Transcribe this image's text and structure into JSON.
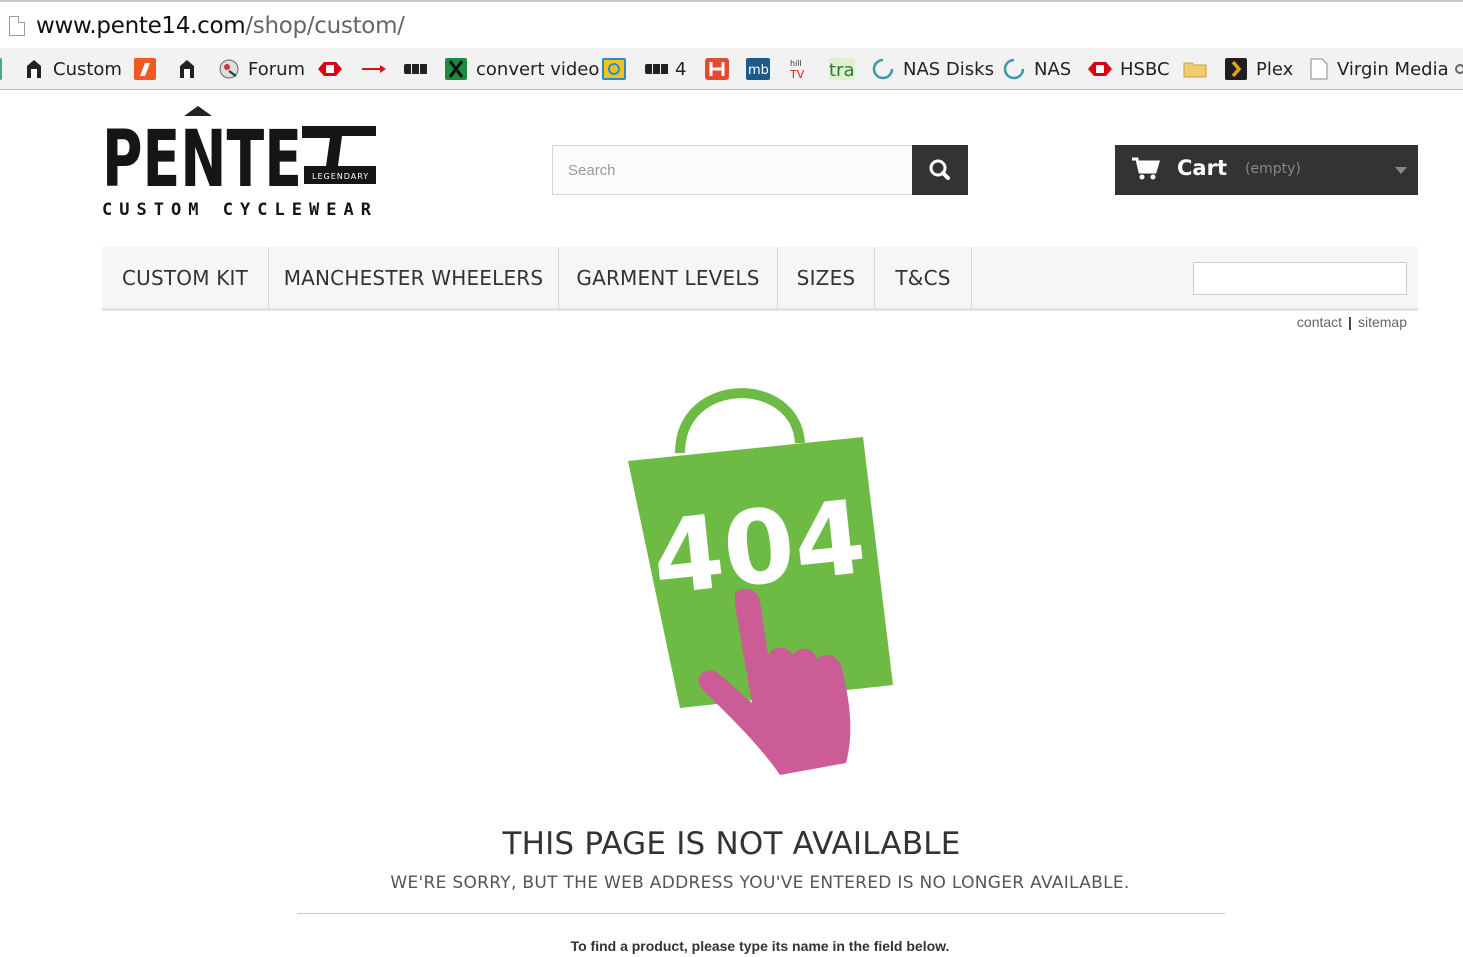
{
  "browser": {
    "url_host": "www.pente14.com",
    "url_path": "/shop/custom/"
  },
  "bookmarks": [
    {
      "label": "Custom",
      "icon": "pente-icon"
    },
    {
      "label": "",
      "icon": "orange-app-icon"
    },
    {
      "label": "",
      "icon": "pente-icon"
    },
    {
      "label": "Forum",
      "icon": "forum-icon"
    },
    {
      "label": "",
      "icon": "hsbc-icon"
    },
    {
      "label": "",
      "icon": "red-arrow-icon"
    },
    {
      "label": "",
      "icon": "bbc-icon"
    },
    {
      "label": "convert video",
      "icon": "convert-icon"
    },
    {
      "label": "",
      "icon": "photo-icon"
    },
    {
      "label": "4",
      "icon": "bbc-icon"
    },
    {
      "label": "",
      "icon": "h-icon"
    },
    {
      "label": "",
      "icon": "mb-icon"
    },
    {
      "label": "",
      "icon": "hill-tv-icon"
    },
    {
      "label": "",
      "icon": "tra-icon"
    },
    {
      "label": "NAS Disks",
      "icon": "spinner-icon"
    },
    {
      "label": "NAS",
      "icon": "spinner-icon"
    },
    {
      "label": "HSBC",
      "icon": "hsbc-icon"
    },
    {
      "label": "",
      "icon": "folder-icon"
    },
    {
      "label": "Plex",
      "icon": "plex-icon"
    },
    {
      "label": "Virgin Media",
      "icon": "page-icon"
    }
  ],
  "header": {
    "search_placeholder": "Search",
    "cart_label": "Cart",
    "cart_status": "(empty)"
  },
  "menu": [
    "CUSTOM KIT",
    "MANCHESTER WHEELERS",
    "GARMENT LEVELS",
    "SIZES",
    "T&CS"
  ],
  "links": {
    "contact": "contact",
    "sitemap": "sitemap"
  },
  "main": {
    "error_code": "404",
    "title": "THIS PAGE IS NOT AVAILABLE",
    "subtitle": "WE'RE SORRY, BUT THE WEB ADDRESS YOU'VE ENTERED IS NO LONGER AVAILABLE.",
    "hint": "To find a product, please type its name in the field below."
  },
  "colors": {
    "dark": "#333333",
    "green_bag": "#6dbb45",
    "pink_hand": "#cc5c96"
  }
}
